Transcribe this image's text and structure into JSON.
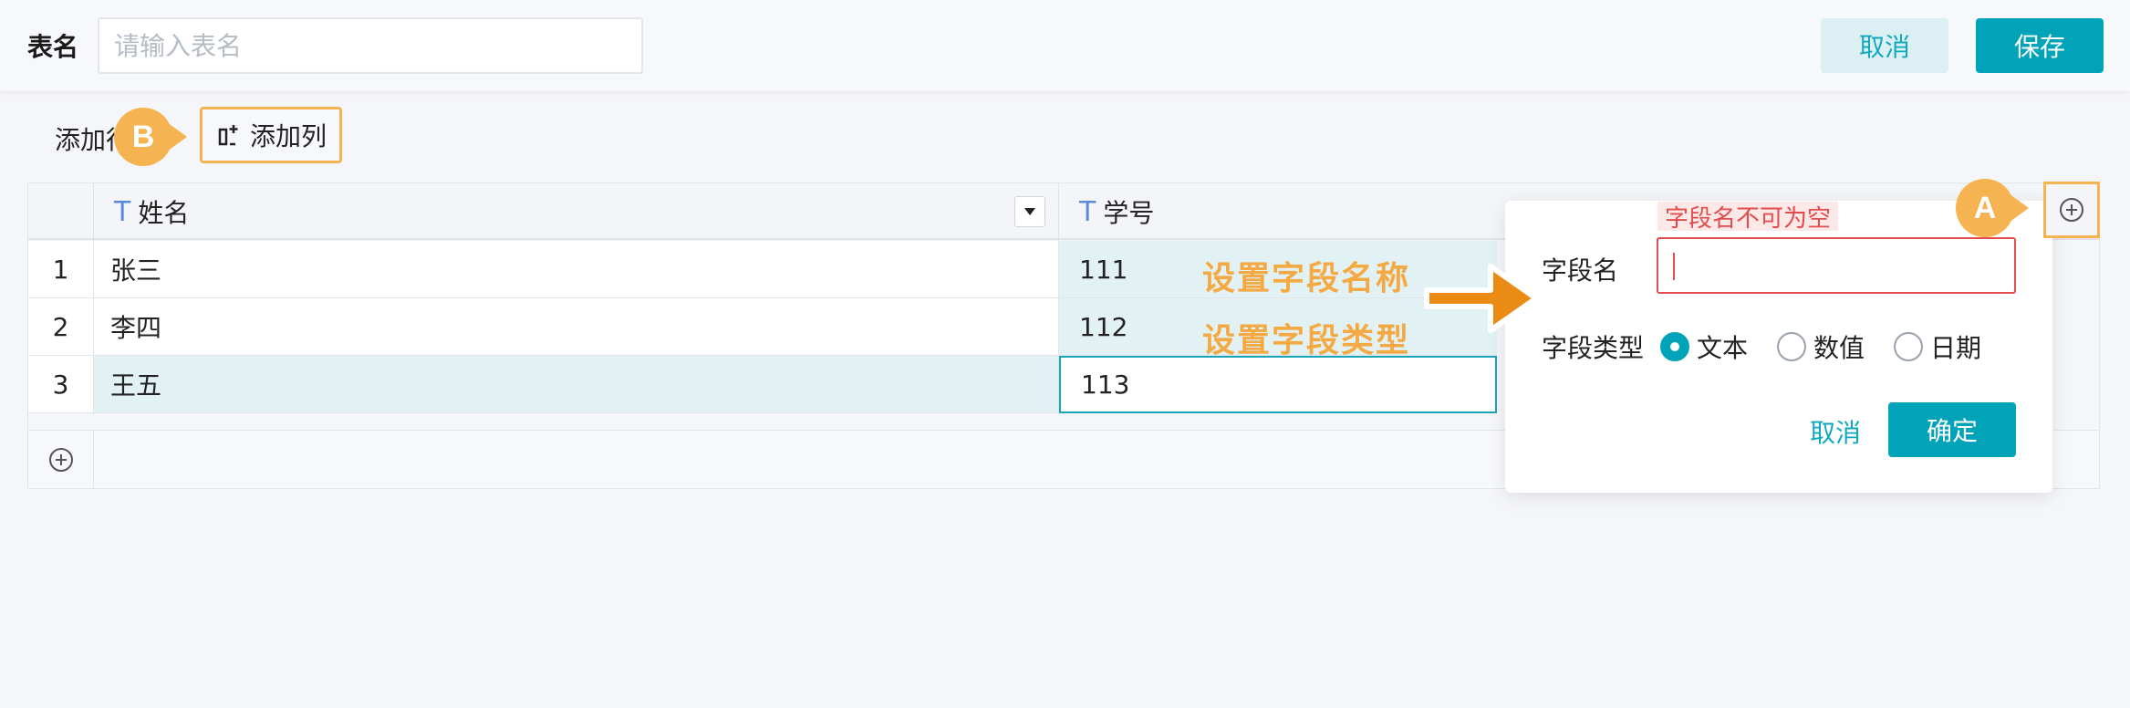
{
  "header": {
    "table_name_label": "表名",
    "table_name_placeholder": "请输入表名",
    "cancel_label": "取消",
    "save_label": "保存"
  },
  "toolbar": {
    "add_row_label": "添加行",
    "add_col_label": "添加列"
  },
  "markers": {
    "a": "A",
    "b": "B"
  },
  "table": {
    "columns": [
      {
        "type_icon": "T",
        "name": "姓名"
      },
      {
        "type_icon": "T",
        "name": "学号"
      }
    ],
    "rows": [
      {
        "num": "1",
        "name": "张三",
        "sid": "111"
      },
      {
        "num": "2",
        "name": "李四",
        "sid": "112"
      },
      {
        "num": "3",
        "name": "王五",
        "sid": "113"
      }
    ]
  },
  "popup": {
    "error_tip": "字段名不可为空",
    "field_name_label": "字段名",
    "field_type_label": "字段类型",
    "types": [
      "文本",
      "数值",
      "日期"
    ],
    "selected_type": "文本",
    "cancel_label": "取消",
    "ok_label": "确定"
  },
  "annotations": {
    "set_name": "设置字段名称",
    "set_type": "设置字段类型"
  },
  "colors": {
    "accent": "#00a3b8",
    "highlight": "#f5b352",
    "error": "#e34d4d"
  }
}
